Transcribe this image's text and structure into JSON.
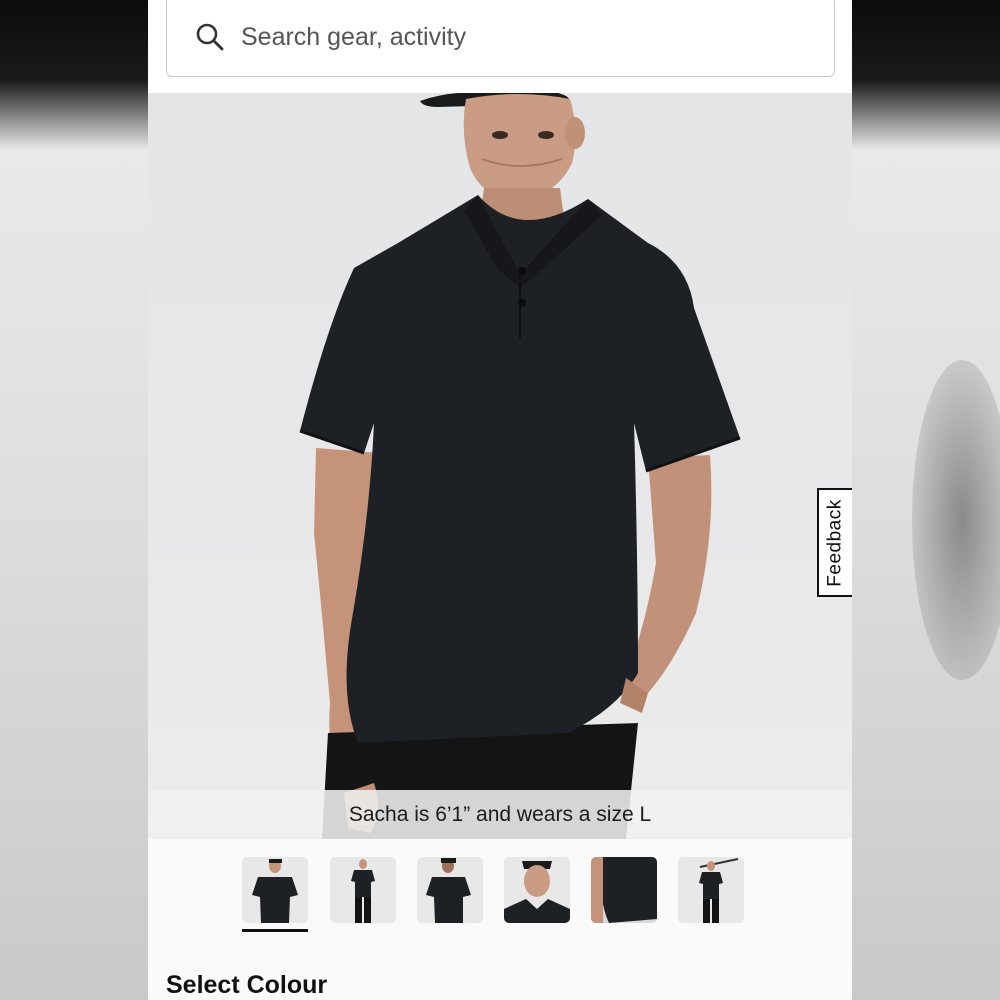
{
  "search": {
    "placeholder": "Search gear, activity",
    "icon": "search-icon"
  },
  "hero": {
    "caption": "Sacha is 6’1” and wears a size L"
  },
  "feedback": {
    "label": "Feedback"
  },
  "gallery": {
    "thumbnails": [
      "front view",
      "full body",
      "back view",
      "close-up with cap",
      "detail",
      "golf swing"
    ],
    "selected_index": 0
  },
  "colour": {
    "heading": "Select Colour"
  },
  "colors": {
    "product": "#1d2024",
    "accent": "#111111"
  }
}
